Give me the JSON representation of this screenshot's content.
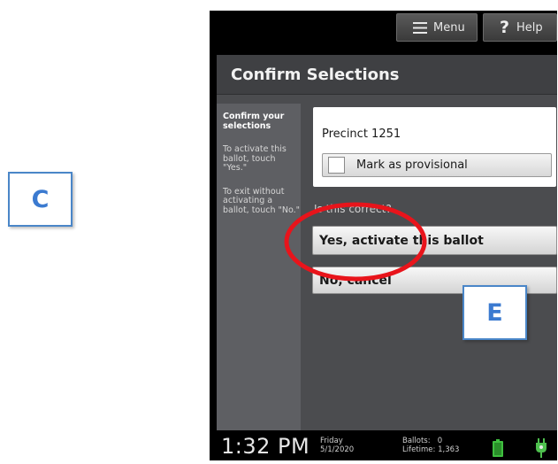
{
  "topbar": {
    "menu_label": "Menu",
    "help_label": "Help"
  },
  "screen": {
    "title": "Confirm Selections"
  },
  "sidebar": {
    "heading": "Confirm your selections",
    "activate_text": "To activate this ballot, touch \"Yes.\"",
    "exit_text": "To exit without activating a ballot, touch \"No.\""
  },
  "main": {
    "precinct": "Precinct 1251",
    "provisional_label": "Mark as provisional",
    "provisional_checked": false,
    "question": "Is this correct?",
    "yes_label": "Yes, activate this ballot",
    "no_label": "No, cancel"
  },
  "status": {
    "time": "1:32 PM",
    "day": "Friday",
    "date": "5/1/2020",
    "ballots_label": "Ballots:",
    "ballots_value": "0",
    "lifetime_label": "Lifetime:",
    "lifetime_value": "1,363"
  },
  "annotations": {
    "left_marker": "C",
    "right_marker": "E",
    "highlight_color": "#e8141b"
  },
  "icons": [
    "menu-icon",
    "help-icon",
    "battery-icon",
    "power-plug-icon"
  ]
}
